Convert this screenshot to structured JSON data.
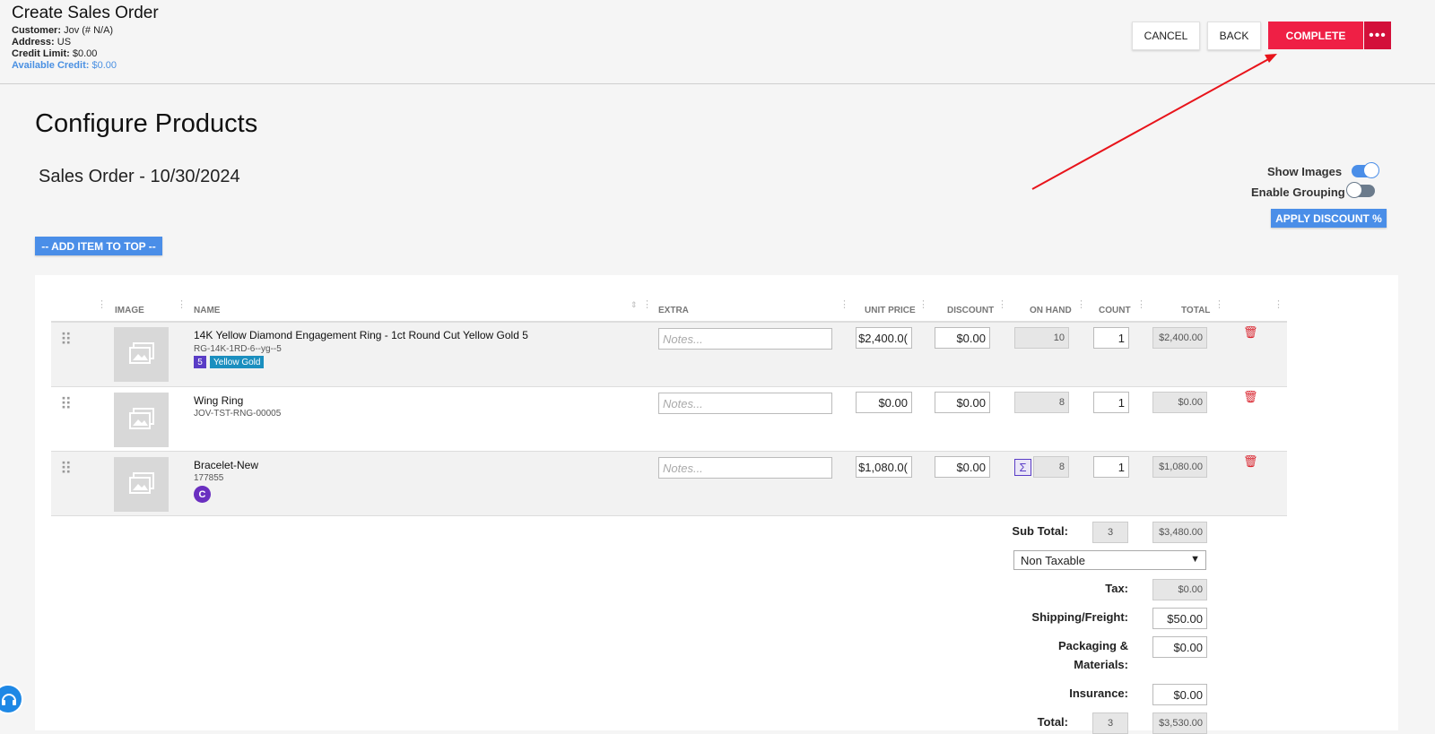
{
  "header": {
    "title": "Create Sales Order",
    "customer_label": "Customer:",
    "customer_value": "Jov (# N/A)",
    "address_label": "Address:",
    "address_value": "US",
    "credit_limit_label": "Credit Limit:",
    "credit_limit_value": "$0.00",
    "available_credit_label": "Available Credit:",
    "available_credit_value": "$0.00",
    "cancel": "CANCEL",
    "back": "BACK",
    "complete": "COMPLETE",
    "more": "•••"
  },
  "page": {
    "heading": "Configure Products",
    "order_title": "Sales Order - 10/30/2024",
    "show_images_label": "Show Images",
    "show_images_on": true,
    "enable_grouping_label": "Enable Grouping",
    "enable_grouping_on": false,
    "apply_discount": "APPLY DISCOUNT %",
    "add_item_top": "-- ADD ITEM TO TOP --"
  },
  "table": {
    "columns": [
      "IMAGE",
      "NAME",
      "EXTRA",
      "UNIT PRICE",
      "DISCOUNT",
      "ON HAND",
      "COUNT",
      "TOTAL"
    ],
    "notes_placeholder": "Notes...",
    "rows": [
      {
        "name": "14K Yellow Diamond Engagement Ring - 1ct Round Cut Yellow Gold 5",
        "sku": "RG-14K-1RD-6--yg--5",
        "badge_num": "5",
        "badge_tag": "Yellow Gold",
        "unit_price": "$2,400.0(",
        "discount": "$0.00",
        "on_hand": "10",
        "count": "1",
        "total": "$2,400.00"
      },
      {
        "name": "Wing Ring",
        "sku": "JOV-TST-RNG-00005",
        "unit_price": "$0.00",
        "discount": "$0.00",
        "on_hand": "8",
        "count": "1",
        "total": "$0.00"
      },
      {
        "name": "Bracelet-New",
        "sku": "177855",
        "badge_c": "C",
        "sigma": "Σ",
        "unit_price": "$1,080.0(",
        "discount": "$0.00",
        "on_hand": "8",
        "count": "1",
        "total": "$1,080.00"
      }
    ]
  },
  "summary": {
    "subtotal_label": "Sub Total:",
    "subtotal_count": "3",
    "subtotal_value": "$3,480.00",
    "tax_select": "Non Taxable",
    "tax_label": "Tax:",
    "tax_value": "$0.00",
    "shipping_label": "Shipping/Freight:",
    "shipping_value": "$50.00",
    "packaging_label_1": "Packaging &",
    "packaging_label_2": "Materials:",
    "packaging_value": "$0.00",
    "insurance_label": "Insurance:",
    "insurance_value": "$0.00",
    "total_label": "Total:",
    "total_count": "3",
    "total_value": "$3,530.00"
  },
  "colors": {
    "complete": "#ef1f45",
    "accent_blue": "#4a8ee8",
    "annotation_arrow": "#e8141b"
  }
}
